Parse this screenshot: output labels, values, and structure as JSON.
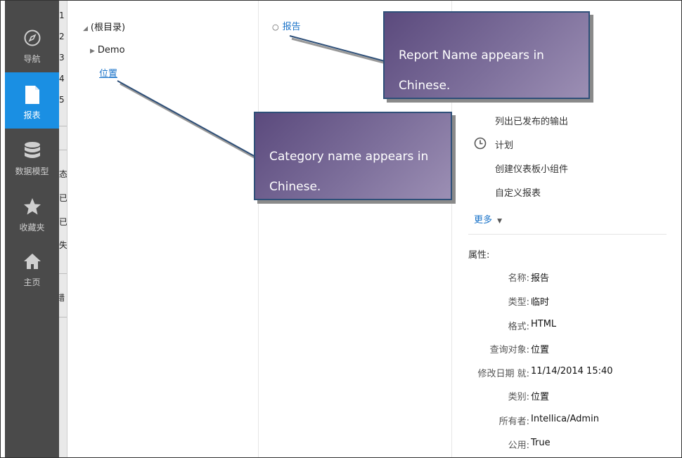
{
  "sidebar": {
    "items": [
      {
        "label": "导航",
        "icon": "compass-icon"
      },
      {
        "label": "报表",
        "icon": "document-icon"
      },
      {
        "label": "数据模型",
        "icon": "database-icon"
      },
      {
        "label": "收藏夹",
        "icon": "star-icon"
      },
      {
        "label": "主页",
        "icon": "home-icon"
      }
    ]
  },
  "strip": {
    "numbers": [
      "1",
      "2",
      "3",
      "4",
      "5"
    ],
    "fragments": [
      "态",
      "已",
      "已",
      "失",
      "错"
    ]
  },
  "tree": {
    "root": "(根目录)",
    "child": "Demo",
    "category": "位置"
  },
  "reports": {
    "items": [
      "报告"
    ]
  },
  "details": {
    "actions": [
      "列出已发布的输出",
      "计划",
      "创建仪表板小组件",
      "自定义报表"
    ],
    "more": "更多",
    "properties_title": "属性:",
    "properties": [
      {
        "key": "名称:",
        "value": "报告"
      },
      {
        "key": "类型:",
        "value": "临时"
      },
      {
        "key": "格式:",
        "value": "HTML"
      },
      {
        "key": "查询对象:",
        "value": "位置"
      },
      {
        "key": "修改日期 就:",
        "value": "11/14/2014  15:40"
      },
      {
        "key": "类别:",
        "value": "位置"
      },
      {
        "key": "所有者:",
        "value": "Intellica/Admin"
      },
      {
        "key": "公用:",
        "value": "True"
      }
    ]
  },
  "callouts": {
    "report_line1": "Report Name appears in",
    "report_line2": "Chinese.",
    "category_line1": "Category name appears in",
    "category_line2": "Chinese."
  },
  "colors": {
    "sidebar_bg": "#4a4a4a",
    "active_accent": "#1a8fe3",
    "link": "#1a73c9",
    "callout_border": "#2e4f78"
  }
}
